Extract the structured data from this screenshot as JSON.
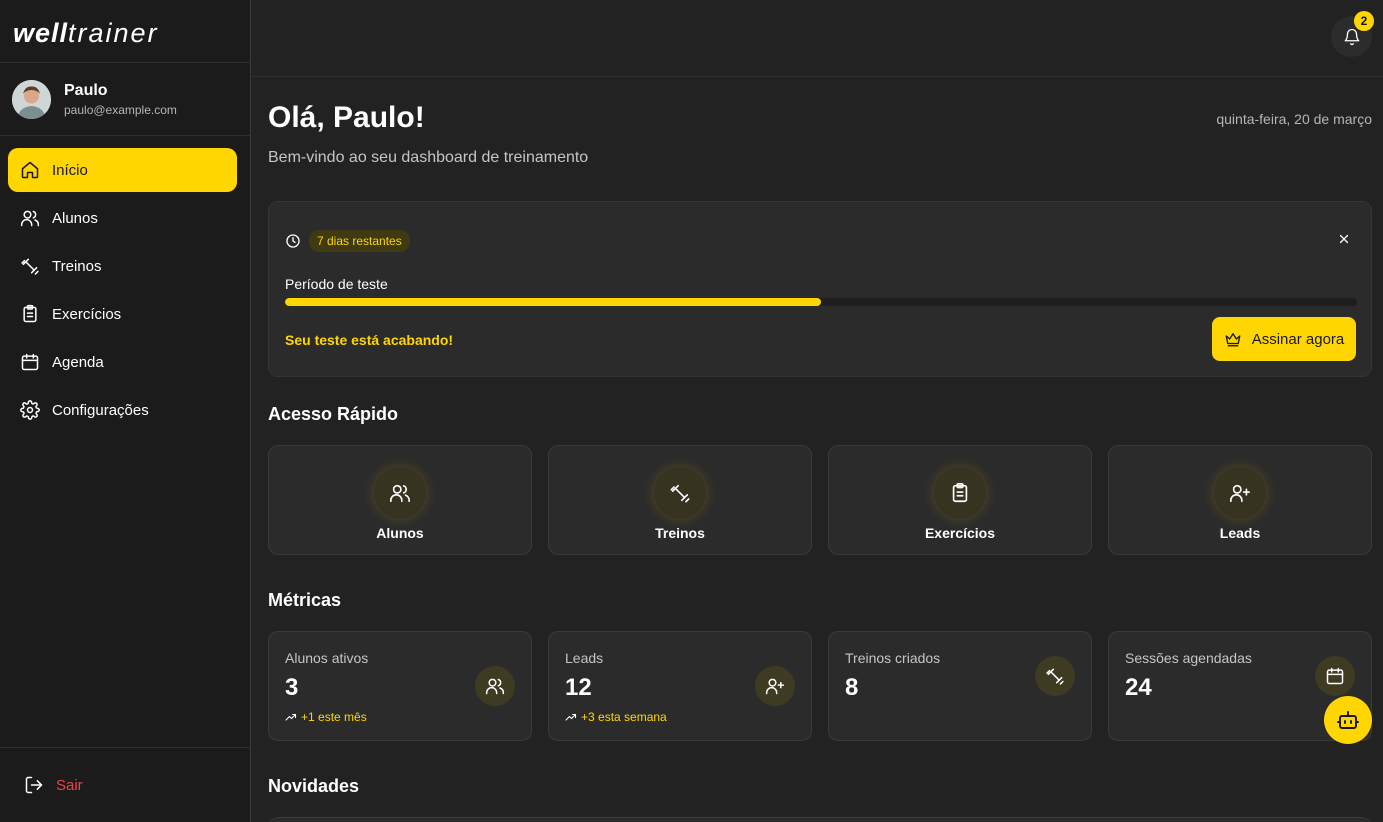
{
  "brand": {
    "bold": "well",
    "light": "trainer"
  },
  "user": {
    "name": "Paulo",
    "email": "paulo@example.com"
  },
  "nav": [
    {
      "label": "Início",
      "icon": "home-icon",
      "active": true
    },
    {
      "label": "Alunos",
      "icon": "users-icon"
    },
    {
      "label": "Treinos",
      "icon": "dumbbell-icon"
    },
    {
      "label": "Exercícios",
      "icon": "clipboard-list-icon"
    },
    {
      "label": "Agenda",
      "icon": "calendar-icon"
    },
    {
      "label": "Configurações",
      "icon": "gear-icon"
    }
  ],
  "logout": {
    "label": "Sair",
    "icon": "logout-icon"
  },
  "notifications": {
    "count": "2",
    "icon": "bell-icon"
  },
  "header": {
    "greeting": "Olá, Paulo!",
    "subtitle": "Bem-vindo ao seu dashboard de treinamento",
    "date": "quinta-feira, 20 de março"
  },
  "trial": {
    "badge": "7 dias restantes",
    "label": "Período de teste",
    "progress_percent": 50,
    "warning": "Seu teste está acabando!",
    "cta": "Assinar agora",
    "colors": {
      "accent": "#ffd600"
    }
  },
  "quick_access": {
    "title": "Acesso Rápido",
    "items": [
      {
        "label": "Alunos",
        "icon": "users-icon"
      },
      {
        "label": "Treinos",
        "icon": "dumbbell-icon"
      },
      {
        "label": "Exercícios",
        "icon": "clipboard-list-icon"
      },
      {
        "label": "Leads",
        "icon": "user-plus-icon"
      }
    ]
  },
  "metrics": {
    "title": "Métricas",
    "items": [
      {
        "label": "Alunos ativos",
        "value": "3",
        "trend": "+1 este mês",
        "icon": "users-icon"
      },
      {
        "label": "Leads",
        "value": "12",
        "trend": "+3 esta semana",
        "icon": "user-plus-icon"
      },
      {
        "label": "Treinos criados",
        "value": "8",
        "icon": "dumbbell-icon"
      },
      {
        "label": "Sessões agendadas",
        "value": "24",
        "icon": "calendar-icon"
      }
    ]
  },
  "news": {
    "title": "Novidades"
  }
}
